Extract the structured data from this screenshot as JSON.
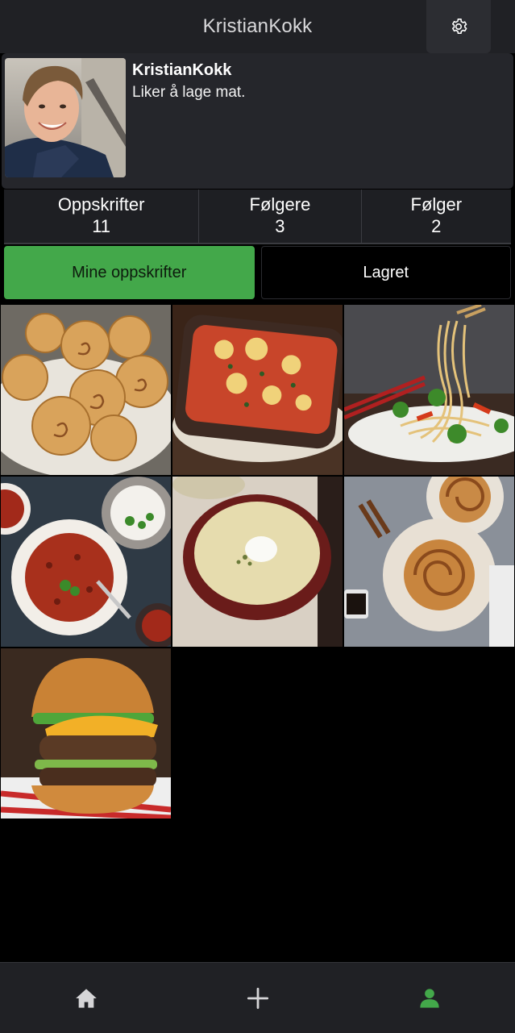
{
  "header": {
    "title": "KristianKokk",
    "settings_icon": "gear-icon"
  },
  "profile": {
    "username": "KristianKokk",
    "bio": "Liker å lage mat."
  },
  "stats": [
    {
      "label": "Oppskrifter",
      "value": "11"
    },
    {
      "label": "Følgere",
      "value": "3"
    },
    {
      "label": "Følger",
      "value": "2"
    }
  ],
  "tabs": {
    "mine": "Mine oppskrifter",
    "saved": "Lagret",
    "active": "mine"
  },
  "recipes": [
    {
      "id": "cinnamon-rolls",
      "icon": "recipe-photo"
    },
    {
      "id": "lasagna",
      "icon": "recipe-photo"
    },
    {
      "id": "noodles",
      "icon": "recipe-photo"
    },
    {
      "id": "chili",
      "icon": "recipe-photo"
    },
    {
      "id": "soup",
      "icon": "recipe-photo"
    },
    {
      "id": "cinnamon-knots",
      "icon": "recipe-photo"
    },
    {
      "id": "burger",
      "icon": "recipe-photo"
    }
  ],
  "nav": {
    "items": [
      "home-icon",
      "plus-icon",
      "user-icon"
    ],
    "active": "user-icon"
  },
  "colors": {
    "accent": "#43a84a",
    "header_bg": "#202125",
    "card_bg": "#25262b"
  }
}
